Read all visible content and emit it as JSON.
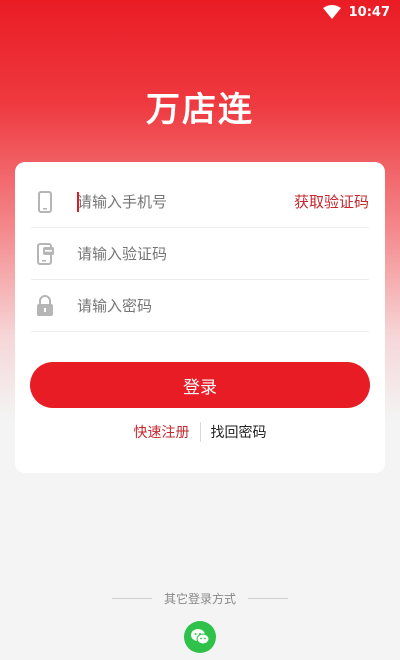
{
  "status_bar": {
    "time": "10:47",
    "wifi_icon": "wifi-icon"
  },
  "app": {
    "title": "万店连"
  },
  "form": {
    "phone_placeholder": "请输入手机号",
    "get_code_label": "获取验证码",
    "code_placeholder": "请输入验证码",
    "password_placeholder": "请输入密码",
    "login_label": "登录",
    "register_label": "快速注册",
    "forgot_label": "找回密码"
  },
  "other_login": {
    "label": "其它登录方式",
    "wechat_icon": "wechat-icon"
  },
  "colors": {
    "accent": "#e81c24",
    "link_red": "#c6272d",
    "wechat_green": "#2ec24a"
  }
}
